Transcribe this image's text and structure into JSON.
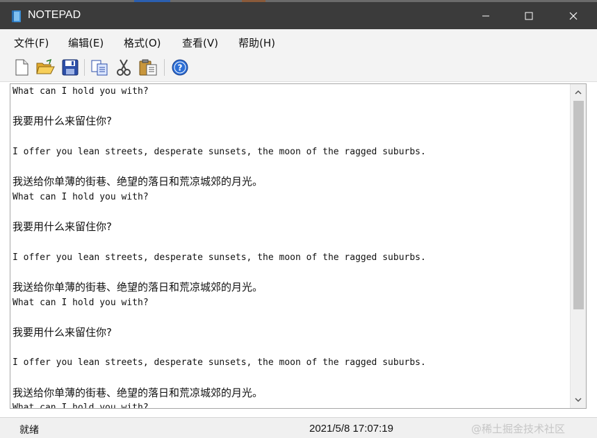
{
  "window": {
    "title": "NOTEPAD",
    "accent_color": "#3b3b3b"
  },
  "menubar": {
    "items": [
      {
        "label": "文件(F)"
      },
      {
        "label": "编辑(E)"
      },
      {
        "label": "格式(O)"
      },
      {
        "label": "查看(V)"
      },
      {
        "label": "帮助(H)"
      }
    ]
  },
  "toolbar": {
    "buttons": [
      {
        "icon": "new-file-icon"
      },
      {
        "icon": "open-folder-icon"
      },
      {
        "icon": "save-icon"
      },
      {
        "icon": "copy-icon"
      },
      {
        "icon": "cut-icon"
      },
      {
        "icon": "paste-icon"
      },
      {
        "icon": "help-icon"
      }
    ]
  },
  "editor": {
    "lines": [
      {
        "text": "What can I hold you with?",
        "lang": "en"
      },
      {
        "text": "",
        "lang": "en"
      },
      {
        "text": "我要用什么来留住你?",
        "lang": "zh"
      },
      {
        "text": "",
        "lang": "en"
      },
      {
        "text": "I offer you lean streets, desperate sunsets, the moon of the ragged suburbs.",
        "lang": "en"
      },
      {
        "text": "",
        "lang": "en"
      },
      {
        "text": "我送给你单薄的街巷、绝望的落日和荒凉城郊的月光。",
        "lang": "zh"
      },
      {
        "text": "What can I hold you with?",
        "lang": "en"
      },
      {
        "text": "",
        "lang": "en"
      },
      {
        "text": "我要用什么来留住你?",
        "lang": "zh"
      },
      {
        "text": "",
        "lang": "en"
      },
      {
        "text": "I offer you lean streets, desperate sunsets, the moon of the ragged suburbs.",
        "lang": "en"
      },
      {
        "text": "",
        "lang": "en"
      },
      {
        "text": "我送给你单薄的街巷、绝望的落日和荒凉城郊的月光。",
        "lang": "zh"
      },
      {
        "text": "What can I hold you with?",
        "lang": "en"
      },
      {
        "text": "",
        "lang": "en"
      },
      {
        "text": "我要用什么来留住你?",
        "lang": "zh"
      },
      {
        "text": "",
        "lang": "en"
      },
      {
        "text": "I offer you lean streets, desperate sunsets, the moon of the ragged suburbs.",
        "lang": "en"
      },
      {
        "text": "",
        "lang": "en"
      },
      {
        "text": "我送给你单薄的街巷、绝望的落日和荒凉城郊的月光。",
        "lang": "zh"
      },
      {
        "text": "What can I hold you with?",
        "lang": "en"
      }
    ]
  },
  "statusbar": {
    "status": "就绪",
    "datetime": "2021/5/8 17:07:19",
    "watermark": "@稀土掘金技术社区"
  }
}
